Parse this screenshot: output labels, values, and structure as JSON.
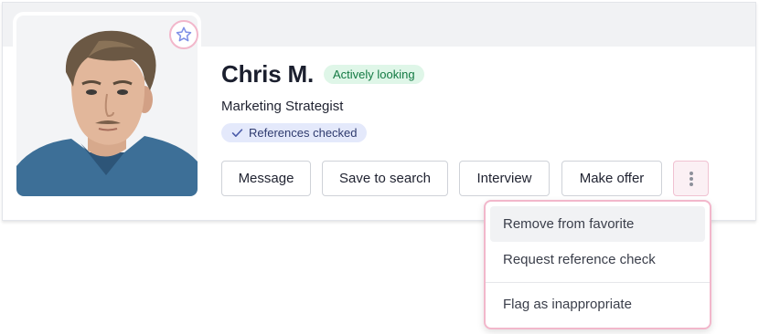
{
  "candidate": {
    "name": "Chris M.",
    "status": "Actively looking",
    "job_title": "Marketing Strategist",
    "references_badge": "References checked",
    "photo_icon": "person-portrait",
    "favorite_icon": "star-icon"
  },
  "actions": {
    "message": "Message",
    "save_to_search": "Save to search",
    "interview": "Interview",
    "make_offer": "Make offer",
    "more_icon": "vertical-dots-icon"
  },
  "menu": {
    "items": [
      {
        "label": "Remove from favorite"
      },
      {
        "label": "Request reference check"
      },
      {
        "label": "Flag as inappropriate"
      }
    ]
  },
  "colors": {
    "status_badge_bg": "#dff6e8",
    "status_badge_text": "#137a43",
    "ref_badge_bg": "#e4e9fb",
    "favorite_ring": "#f2b7cb",
    "star": "#7e8fe6"
  }
}
